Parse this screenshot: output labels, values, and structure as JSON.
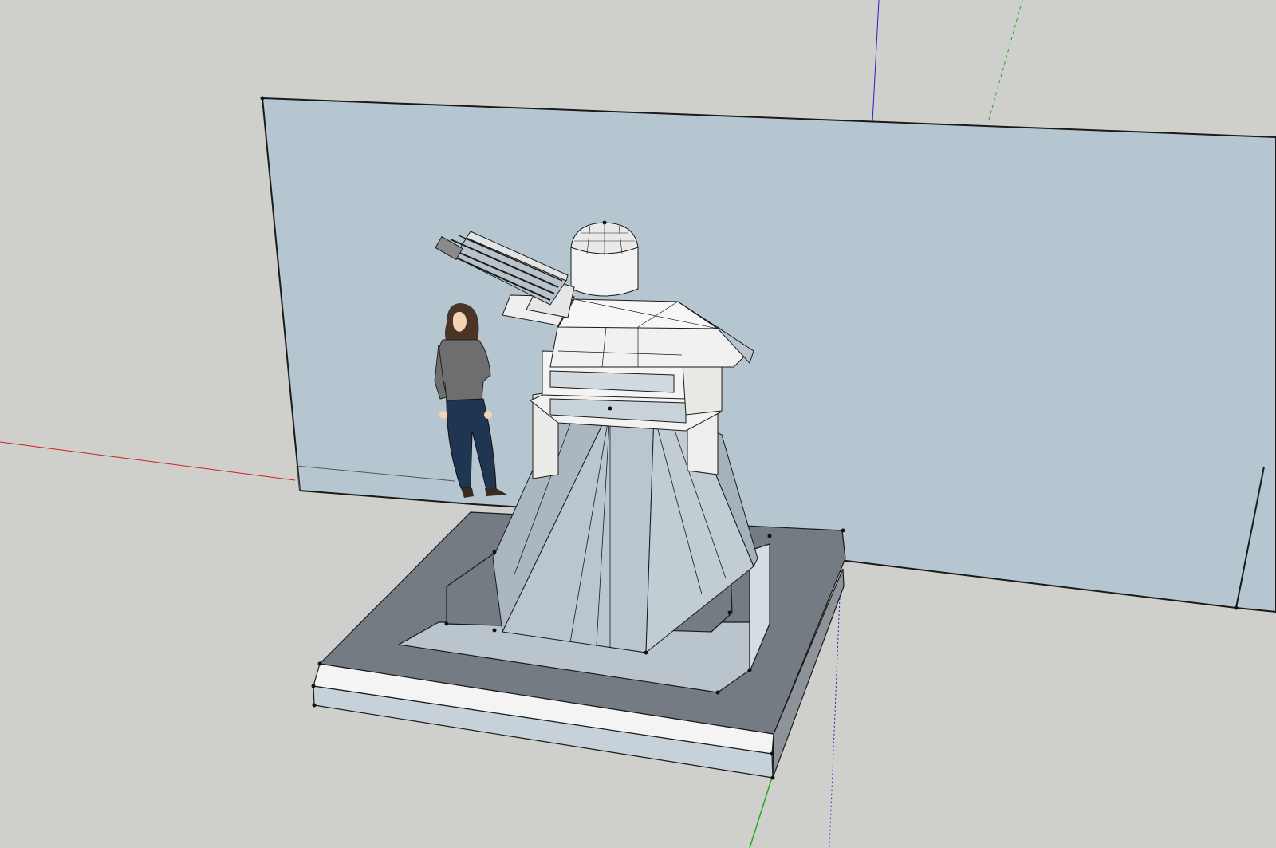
{
  "app": {
    "view": "3d-modeling-viewport",
    "background_color": "#cfcfcb"
  },
  "axes": {
    "red_color": "#cc2222",
    "green_color": "#22aa22",
    "blue_color": "#2222cc"
  },
  "scene": {
    "wall_color": "#b6c6d1",
    "edge_color": "#1a1a1a",
    "model_light": "#f2f2f2",
    "model_mid": "#b9c4cc",
    "model_dark": "#747b82",
    "scale_figure": {
      "shirt_color": "#6e6e6e",
      "pants_color": "#1f3552",
      "skin_color": "#f3d3b3",
      "hair_color": "#4a3426"
    }
  }
}
